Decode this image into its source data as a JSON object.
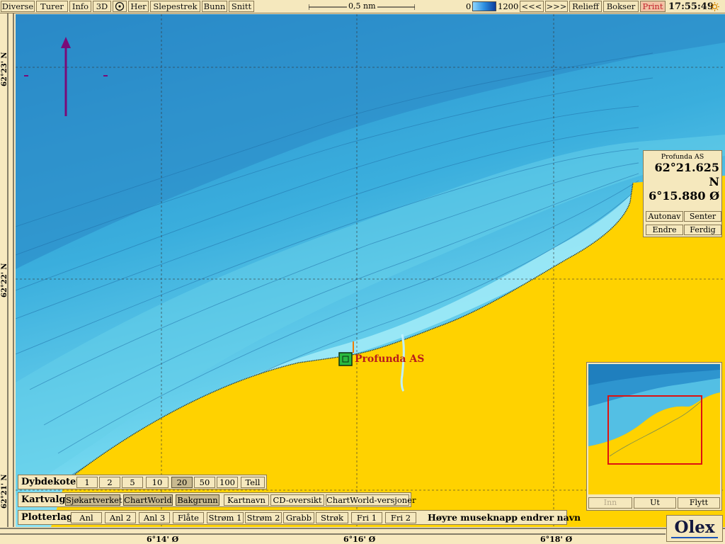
{
  "top_menu": {
    "buttons": [
      "Diverse",
      "Turer",
      "Info",
      "3D",
      "Her",
      "Slepestrek",
      "Bunn",
      "Snitt"
    ],
    "scale_label": "0,5 nm",
    "depth_min": "0",
    "depth_max": "1200",
    "nav_prev": "<<<",
    "nav_next": ">>>",
    "relieff": "Relieff",
    "bokser": "Bokser",
    "print": "Print",
    "clock": "17:55:49"
  },
  "ruler": {
    "lat_labels": [
      "62°23' N",
      "62°22' N",
      "62°21' N"
    ],
    "lon_labels": [
      "6°14' Ø",
      "6°16' Ø",
      "6°18' Ø"
    ]
  },
  "map": {
    "marker_label": "Profunda AS",
    "colors": {
      "land": "#ffd200",
      "shallow": "#aef3fb",
      "deep": "#2b8fca"
    }
  },
  "info_panel": {
    "title": "Profunda AS",
    "lat": "62°21.625 N",
    "lon": "6°15.880 Ø",
    "buttons": [
      "Autonav",
      "Senter",
      "Endre",
      "Ferdig"
    ]
  },
  "overview": {
    "buttons": [
      "Inn",
      "Ut",
      "Flytt"
    ]
  },
  "dybdekoter": {
    "label": "Dybdekoter",
    "values": [
      "1",
      "2",
      "5",
      "10",
      "20",
      "50",
      "100",
      "Tell"
    ],
    "active": "20"
  },
  "kartvalg": {
    "label": "Kartvalg",
    "buttons": [
      "Sjøkartverket",
      "ChartWorld",
      "Bakgrunn",
      "Kartnavn",
      "CD-oversikt",
      "ChartWorld-versjoner"
    ]
  },
  "plotterlag": {
    "label": "Plotterlag",
    "buttons": [
      "Anl",
      "Anl 2",
      "Anl 3",
      "Flåte",
      "Strøm 1",
      "Strøm 2",
      "Grabb",
      "Strøk",
      "Fri 1",
      "Fri 2"
    ],
    "hint": "Høyre museknapp endrer navn"
  },
  "brand": "Olex"
}
